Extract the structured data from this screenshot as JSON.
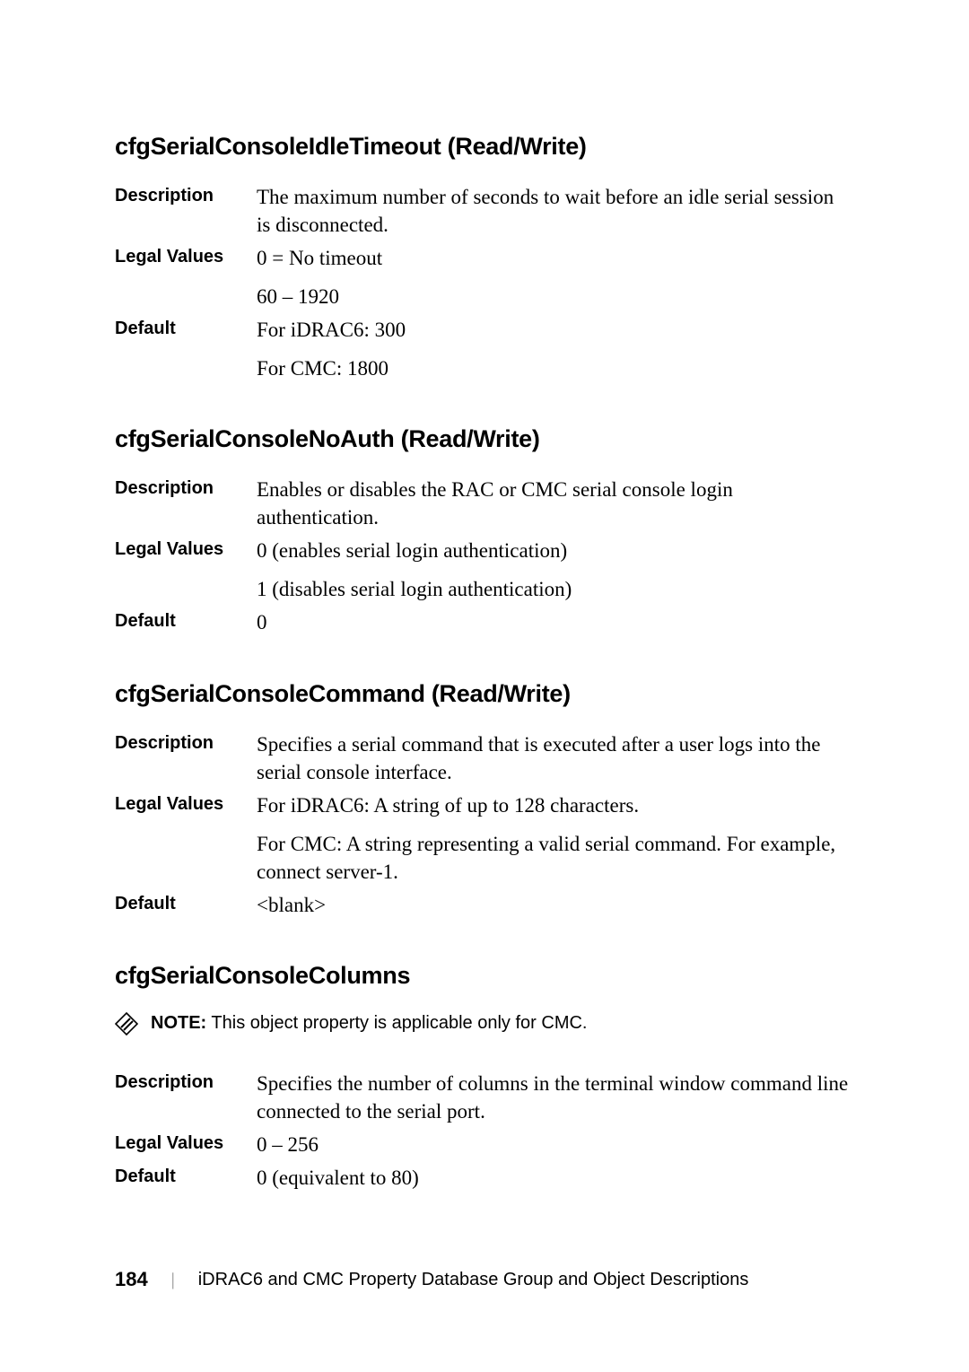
{
  "sections": [
    {
      "title": "cfgSerialConsoleIdleTimeout (Read/Write)",
      "rows": [
        {
          "label": "Description",
          "lines": [
            "The maximum number of seconds to wait before an idle serial session is disconnected."
          ]
        },
        {
          "label": "Legal Values",
          "lines": [
            "0 = No timeout",
            "60 – 1920"
          ]
        },
        {
          "label": "Default",
          "lines": [
            "For iDRAC6: 300",
            "For CMC: 1800"
          ]
        }
      ]
    },
    {
      "title": "cfgSerialConsoleNoAuth (Read/Write)",
      "rows": [
        {
          "label": "Description",
          "lines": [
            "Enables or disables the RAC or CMC serial console login authentication."
          ]
        },
        {
          "label": "Legal Values",
          "lines": [
            "0 (enables serial login authentication)",
            "1 (disables serial login authentication)"
          ]
        },
        {
          "label": "Default",
          "lines": [
            "0"
          ]
        }
      ]
    },
    {
      "title": "cfgSerialConsoleCommand (Read/Write)",
      "rows": [
        {
          "label": "Description",
          "lines": [
            "Specifies a serial command that is executed after a user logs into the serial console interface."
          ]
        },
        {
          "label": "Legal Values",
          "lines": [
            "For iDRAC6: A string of up to 128 characters.",
            "For CMC: A string representing a valid serial command. For example, connect server-1."
          ]
        },
        {
          "label": "Default",
          "lines": [
            "<blank>"
          ]
        }
      ]
    },
    {
      "title": "cfgSerialConsoleColumns",
      "note": {
        "label": "NOTE:",
        "text": " This object property is applicable only for CMC."
      },
      "rows": [
        {
          "label": "Description",
          "lines": [
            "Specifies the number of columns in the terminal window command line connected to the serial port."
          ]
        },
        {
          "label": "Legal Values",
          "lines": [
            "0 – 256"
          ]
        },
        {
          "label": "Default",
          "lines": [
            "0 (equivalent to 80)"
          ]
        }
      ]
    }
  ],
  "footer": {
    "page": "184",
    "title": "iDRAC6 and CMC Property Database Group and Object Descriptions"
  }
}
